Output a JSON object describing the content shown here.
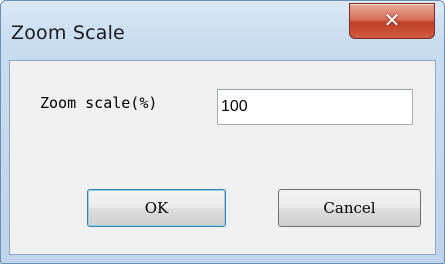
{
  "window": {
    "title": "Zoom Scale",
    "close_icon": "close-icon"
  },
  "form": {
    "zoom_label": "Zoom scale(%)",
    "zoom_value": "100"
  },
  "buttons": {
    "ok_label": "OK",
    "cancel_label": "Cancel"
  },
  "colors": {
    "close_button": "#c1402a",
    "dialog_background": "#f0f0f0",
    "frame": "#c9dcf1",
    "default_button_border": "#3c7fb1"
  }
}
